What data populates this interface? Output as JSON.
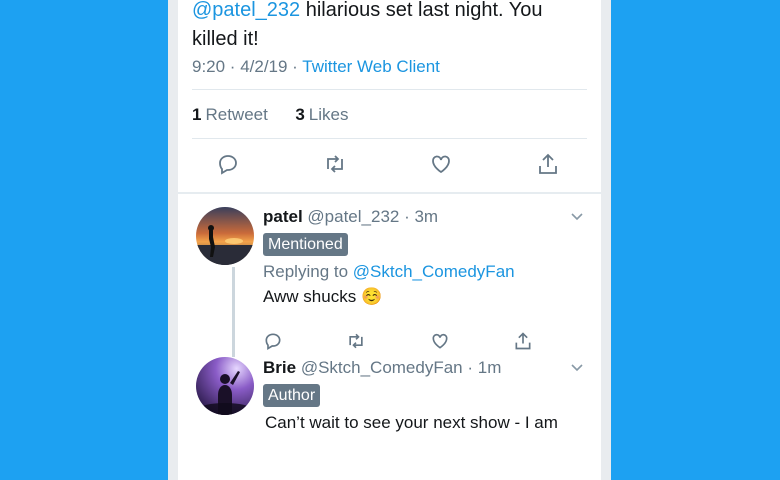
{
  "tweet": {
    "mention": "@patel_232",
    "text": " hilarious set last night. You killed it!",
    "time": "9:20 · 4/2/19 ·",
    "client": "Twitter Web Client",
    "retweets_count": "1",
    "retweets_label": "Retweet",
    "likes_count": "3",
    "likes_label": "Likes"
  },
  "replies": [
    {
      "name": "patel",
      "handle": "@patel_232 · 3m",
      "badge": "Mentioned",
      "replying_prefix": "Replying to ",
      "replying_to": "@Sktch_ComedyFan",
      "text": "Aww shucks ☺️"
    },
    {
      "name": "Brie",
      "handle": "@Sktch_ComedyFan · 1m",
      "badge": "Author",
      "text": "Can’t wait to see your next show - I am"
    }
  ],
  "icons": {
    "reply": "reply-icon",
    "retweet": "retweet-icon",
    "like": "heart-icon",
    "share": "share-icon",
    "chevron": "chevron-down-icon"
  },
  "colors": {
    "background": "#1da1f2",
    "link": "#1b95e0",
    "muted": "#657786",
    "badge": "#657786"
  }
}
